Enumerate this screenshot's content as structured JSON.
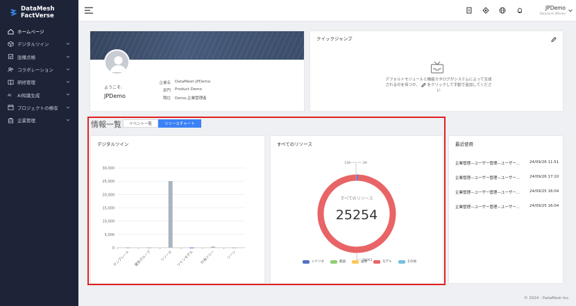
{
  "app": {
    "brand": "DataMesh FactVerse"
  },
  "nav": [
    {
      "label": "ホームページ",
      "icon": "home-icon",
      "active": true,
      "chevron": false
    },
    {
      "label": "デジタルツイン",
      "icon": "cube-icon",
      "active": false,
      "chevron": true
    },
    {
      "label": "設備点検",
      "icon": "checklist-icon",
      "active": false,
      "chevron": true
    },
    {
      "label": "コラボレーション",
      "icon": "users-icon",
      "active": false,
      "chevron": true
    },
    {
      "label": "研修管理",
      "icon": "book-icon",
      "active": false,
      "chevron": true
    },
    {
      "label": "AI知識生成",
      "icon": "ai-icon",
      "active": false,
      "chevron": true
    },
    {
      "label": "プロジェクトの検収",
      "icon": "calendar-icon",
      "active": false,
      "chevron": true
    },
    {
      "label": "企業管理",
      "icon": "building-icon",
      "active": false,
      "chevron": true
    }
  ],
  "header": {
    "user_name": "JPDemo",
    "user_org": "Datamesh JPDemo"
  },
  "profile": {
    "welcome": "ようこそ:",
    "user": "JPDemo",
    "fields": [
      {
        "k": "企業名",
        "v": "DataMesh-JPDemo"
      },
      {
        "k": "部門",
        "v": "Product Demo"
      },
      {
        "k": "職位",
        "v": "Demo,企業管理者"
      }
    ]
  },
  "quick_jump": {
    "title": "クイックジャンプ",
    "empty_text_1": "デフォルトモジュールと機能カタログがシステムによって生成",
    "empty_text_2": "されるのを待つか、",
    "empty_text_3": "をクリックして手動で追加してくださ",
    "empty_text_4": "い"
  },
  "overview": {
    "title": "情報一覧",
    "tabs": [
      "イベント一覧",
      "リソースチャート"
    ],
    "selected_tab": 1
  },
  "bar_card": {
    "title": "デジタルツイン"
  },
  "donut_card": {
    "title": "すべてのリソース",
    "center_label": "すべてのリソース",
    "center_value": "25254"
  },
  "recent": {
    "title": "最近使用",
    "items": [
      {
        "name": "企業管理—ユーザー管理—ユーザー...",
        "time": "24/09/26 11:51"
      },
      {
        "name": "企業管理—ユーザー管理—ユーザー...",
        "time": "24/09/26 17:10"
      },
      {
        "name": "企業管理—ユーザー管理—ユーザー...",
        "time": "24/09/25 16:04"
      },
      {
        "name": "企業管理—ユーザー管理—ユーザー...",
        "time": "24/09/25 16:04"
      }
    ]
  },
  "footer": {
    "text": "© 2024 - DataMesh Inc."
  },
  "chart_data": [
    {
      "type": "bar",
      "title": "デジタルツイン",
      "categories": [
        "テンプレート",
        "属性グループ",
        "リソース",
        "ツインモデル",
        "行為ツリー",
        "シーン"
      ],
      "values": [
        60,
        60,
        25063,
        60,
        400,
        60
      ],
      "ylim": [
        0,
        30000
      ],
      "yticks": [
        "30,000",
        "25,000",
        "20,000",
        "15,000",
        "10,000",
        "5,000",
        "0"
      ],
      "grid": true,
      "colors": [
        "#a9b4bd",
        "#a9b4bd",
        "#a9b4bd",
        "#3b82f6",
        "#a9b4bd",
        "#a9b4bd"
      ]
    },
    {
      "type": "pie",
      "title": "すべてのリソース",
      "series": [
        {
          "name": "シナリオ",
          "value": 139,
          "color": "#5470c6"
        },
        {
          "name": "範囲",
          "value": 0,
          "color": "#91cc75"
        },
        {
          "name": "画像",
          "value": 0,
          "color": "#fac858"
        },
        {
          "name": "モデル",
          "value": 25063,
          "color": "#e86466"
        },
        {
          "name": "その他",
          "value": 29,
          "color": "#73c0de"
        }
      ],
      "labels": [
        {
          "text": "139"
        },
        {
          "text": "29"
        },
        {
          "text": "25063"
        }
      ],
      "legend": "bottom"
    }
  ]
}
